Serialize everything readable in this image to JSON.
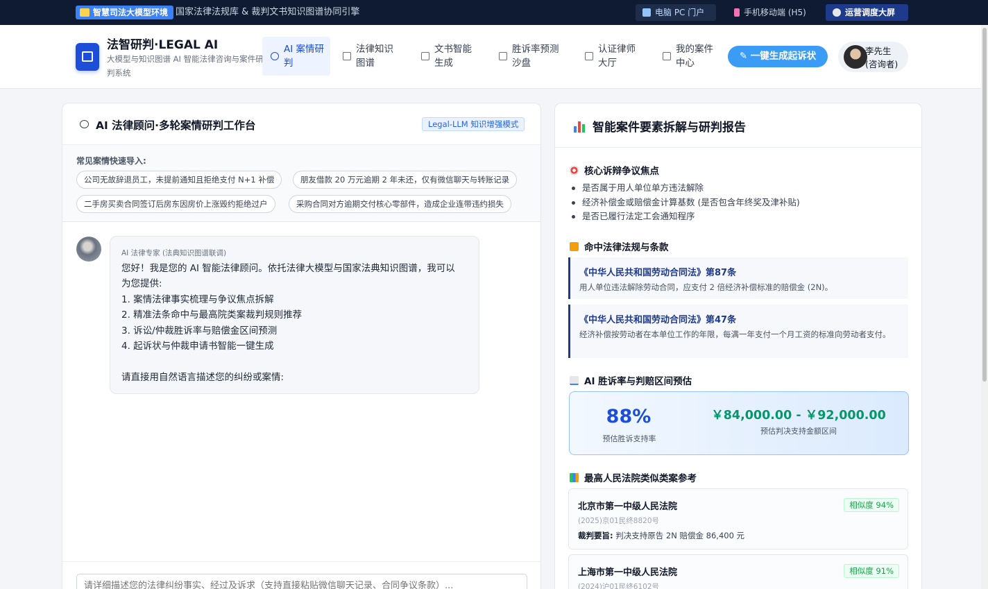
{
  "topbar": {
    "env_badge": "智慧司法大模型环境",
    "subtitle": "国家法律法规库 & 裁判文书知识图谱协同引擎",
    "links": [
      {
        "label": "电脑 PC 门户",
        "icon": "desktop-icon"
      },
      {
        "label": "手机移动端 (H5)",
        "icon": "mobile-icon"
      },
      {
        "label": "运营调度大屏",
        "icon": "gear-icon"
      }
    ]
  },
  "header": {
    "brand_title": "法智研判·LEGAL AI",
    "brand_subtitle": "大模型与知识图谱 AI 智能法律咨询与案件研判系统",
    "nav": [
      {
        "label": "AI 案情研判",
        "icon": "chat-icon",
        "active": true
      },
      {
        "label": "法律知识图谱",
        "icon": "share-icon",
        "active": false
      },
      {
        "label": "文书智能生成",
        "icon": "document-icon",
        "active": false
      },
      {
        "label": "胜诉率预测沙盘",
        "icon": "chart-icon",
        "active": false
      },
      {
        "label": "认证律师大厅",
        "icon": "user-icon",
        "active": false
      },
      {
        "label": "我的案件中心",
        "icon": "folder-icon",
        "active": false
      }
    ],
    "cta_label": "一键生成起诉状",
    "user": {
      "name": "李先生",
      "role": "(咨询者)"
    }
  },
  "workbench": {
    "title": "AI 法律顾问·多轮案情研判工作台",
    "mode_badge": "Legal-LLM 知识增强模式",
    "quick_label": "常见案情快速导入:",
    "quick_chips": [
      "公司无故辞退员工，未提前通知且拒绝支付 N+1 补偿",
      "朋友借款 20 万元逾期 2 年未还，仅有微信聊天与转账记录",
      "二手房买卖合同签订后房东因房价上涨毁约拒绝过户",
      "采购合同对方逾期交付核心零部件，造成企业连带违约损失"
    ],
    "message": {
      "from": "AI 法律专家 (法典知识图谱联调)",
      "lines": [
        "您好！我是您的 AI 智能法律顾问。依托法律大模型与国家法典知识图谱，我可以",
        "为您提供:",
        "1. 案情法律事实梳理与争议焦点拆解",
        "2. 精准法条命中与最高院类案裁判规则推荐",
        "3. 诉讼/仲裁胜诉率与赔偿金区间预测",
        "4. 起诉状与仲裁申请书智能一键生成",
        "",
        "请直接用自然语言描述您的纠纷或案情:"
      ]
    },
    "input_placeholder": "请详细描述您的法律纠纷事实、经过及诉求（支持直接粘贴微信聊天记录、合同争议条款）..."
  },
  "report": {
    "title": "智能案件要素拆解与研判报告",
    "disputes_title": "核心诉辩争议焦点",
    "disputes": [
      "是否属于用人单位单方违法解除",
      "经济补偿金或赔偿金计算基数 (是否包含年终奖及津补贴)",
      "是否已履行法定工会通知程序"
    ],
    "laws_title": "命中法律法规与条款",
    "laws": [
      {
        "title": "《中华人民共和国劳动合同法》第87条",
        "desc": "用人单位违法解除劳动合同，应支付 2 倍经济补偿标准的赔偿金 (2N)。"
      },
      {
        "title": "《中华人民共和国劳动合同法》第47条",
        "desc": "经济补偿按劳动者在本单位工作的年限，每满一年支付一个月工资的标准向劳动者支付。"
      }
    ],
    "prediction_title": "AI 胜诉率与判赔区间预估",
    "prediction": {
      "rate": "88%",
      "rate_label": "预估胜诉支持率",
      "range": "￥84,000.00 - ￥92,000.00",
      "range_label": "预估判决支持金额区间"
    },
    "cases_title": "最高人民法院类似类案参考",
    "cases": [
      {
        "court": "北京市第一中级人民法院",
        "similarity": "相似度 94%",
        "case_no": "(2025)京01民终8820号",
        "gist_label": "裁判要旨:",
        "gist": "判决支持原告 2N 赔偿金 86,400 元"
      },
      {
        "court": "上海市第一中级人民法院",
        "similarity": "相似度 91%",
        "case_no": "(2024)沪01民终6102号",
        "gist_label": "",
        "gist": ""
      }
    ]
  },
  "colors": {
    "primary": "#1d4ed8",
    "cta": "#3b9cf6",
    "topbar": "#0f1b33",
    "success": "#059669"
  }
}
